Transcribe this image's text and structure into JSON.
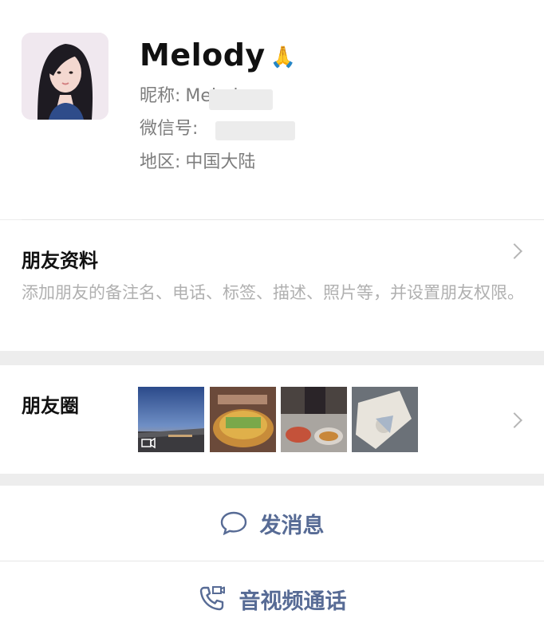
{
  "profile": {
    "display_name": "Melody",
    "name_emoji": "🙏",
    "nickname_label": "昵称:",
    "nickname_value": "Melody",
    "wechat_id_label": "微信号:",
    "region_label": "地区:",
    "region_value": "中国大陆"
  },
  "friend_profile": {
    "title": "朋友资料",
    "description": "添加朋友的备注名、电话、标签、描述、照片等，并设置朋友权限。"
  },
  "moments": {
    "title": "朋友圈",
    "thumbnails": [
      {
        "name": "sunset-video-thumb",
        "has_video_icon": true
      },
      {
        "name": "food-skewers-thumb"
      },
      {
        "name": "hotpot-dinner-thumb"
      },
      {
        "name": "sketch-drawing-thumb"
      }
    ]
  },
  "actions": {
    "message_label": "发消息",
    "call_label": "音视频通话"
  },
  "colors": {
    "link_blue": "#576b95",
    "secondary_text": "#7d7d7d",
    "hint_text": "#b0b0b0",
    "background": "#ededed"
  }
}
